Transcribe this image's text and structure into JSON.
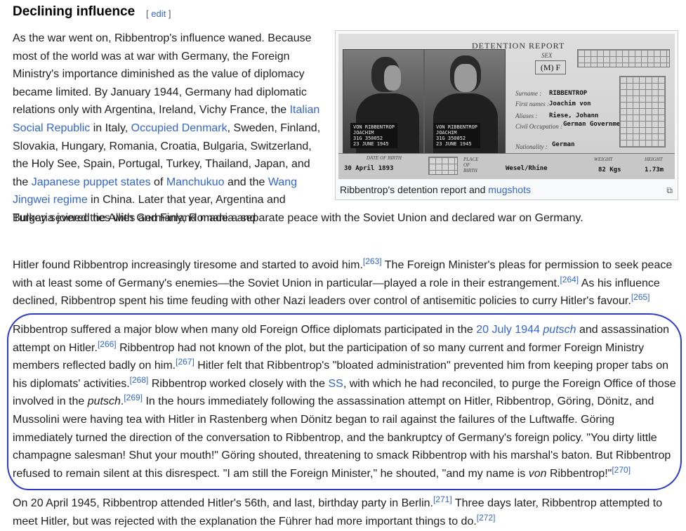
{
  "section": {
    "title": "Declining influence",
    "edit_label": "edit",
    "bracket_open": "[",
    "bracket_close": "]"
  },
  "figure": {
    "caption_text": "Ribbentrop's detention report and ",
    "caption_link": "mugshots",
    "enlarge_icon": "enlarge-icon",
    "card": {
      "header": "DETENTION REPORT",
      "sex_label": "SEX",
      "sex_value": "(M) F",
      "surname_label": "Surname :",
      "surname_value": "RIBBENTROP",
      "first_label": "First names :",
      "first_value": "Joachim von",
      "aliases_label": "Aliases :",
      "aliases_value": "Riese, Johann",
      "occupation_label": "Civil Occupation :",
      "occupation_value": "German Government",
      "nationality_label": "Nationality :",
      "nationality_value": "German",
      "dob_label": "DATE OF BIRTH",
      "dob_value": "30 April 1893",
      "birthplace_label": "PLACE OF BIRTH",
      "birthplace_value": "Wesel/Rhine",
      "weight_label": "WEIGHT",
      "weight_value": "82 Kgs",
      "height_label": "HEIGHT",
      "height_value": "1.73m",
      "plate_left": "VON RIBBENTROP\nJOACHIM\n31G 350052\n23 JUNE 1945",
      "plate_right": "VON RIBBENTROP\nJOACHIM\n31G 350052\n23 JUNE 1945"
    }
  },
  "p1": {
    "t1": "As the war went on, Ribbentrop's influence waned. Because most of the world was at war with Germany, the Foreign Ministry's importance diminished as the value of diplomacy became limited. By January 1944, Germany had diplomatic relations only with Argentina, Ireland, Vichy France, the ",
    "l1": "Italian Social Republic",
    "t2": " in Italy, ",
    "l2": "Occupied Denmark",
    "t3": ", Sweden, Finland, Slovakia, Hungary, Romania, Croatia, Bulgaria, Switzerland, the Holy See, Spain, Portugal, Turkey, Thailand, Japan, and the ",
    "l3": "Japanese puppet states",
    "t4": " of ",
    "l4": "Manchukuo",
    "t5": " and the ",
    "l5": "Wang Jingwei regime",
    "t6": " in China. Later that year, Argentina and Turkey severed ties with Germany; Romania and",
    "tail": "Bulgaria joined the Allies and Finland made a separate peace with the Soviet Union and declared war on Germany."
  },
  "p2": {
    "t1": "Hitler found Ribbentrop increasingly tiresome and started to avoid him.",
    "r1": "[263]",
    "t2": " The Foreign Minister's pleas for permission to seek peace with at least some of Germany's enemies—the Soviet Union in particular—played a role in their estrangement.",
    "r2": "[264]",
    "t3": " As his influence declined, Ribbentrop spent his time feuding with other Nazi leaders over control of antisemitic policies to curry Hitler's favour.",
    "r3": "[265]"
  },
  "p3": {
    "t1": "Ribbentrop suffered a major blow when many old Foreign Office diplomats participated in the ",
    "l1a": "20 July 1944 ",
    "l1b": "putsch",
    "t2": " and assassination attempt on Hitler.",
    "r1": "[266]",
    "t3": " Ribbentrop had not known of the plot, but the participation of so many current and former Foreign Ministry members reflected badly on him.",
    "r2": "[267]",
    "t4": " Hitler felt that Ribbentrop's \"bloated administration\" prevented him from keeping proper tabs on his diplomats' activities.",
    "r3": "[268]",
    "t5": " Ribbentrop worked closely with the ",
    "l2": "SS",
    "t6": ", with which he had reconciled, to purge the Foreign Office of those involved in the ",
    "i1": "putsch",
    "t7": ".",
    "r4": "[269]",
    "t8": " In the hours immediately following the assassination attempt on Hitler, Ribbentrop, Göring, Dönitz, and Mussolini were having tea with Hitler in Rastenberg when Dönitz began to rail against the failures of the Luftwaffe. Göring immediately turned the direction of the conversation to Ribbentrop, and the bankruptcy of Germany's foreign policy. \"You dirty little champagne salesman! Shut your mouth!\" Göring shouted, threatening to smack Ribbentrop with his marshal's baton. But Ribbentrop refused to remain silent at this disrespect. \"I am still the Foreign Minister,\" he shouted, \"and my name is ",
    "i2": "von",
    "t9": " Ribbentrop!\"",
    "r5": "[270]"
  },
  "p4": {
    "t1": "On 20 April 1945, Ribbentrop attended Hitler's 56th, and last, birthday party in Berlin.",
    "r1": "[271]",
    "t2": " Three days later, Ribbentrop attempted to meet Hitler, but was rejected with the explanation the Führer had more important things to do.",
    "r2": "[272]"
  }
}
